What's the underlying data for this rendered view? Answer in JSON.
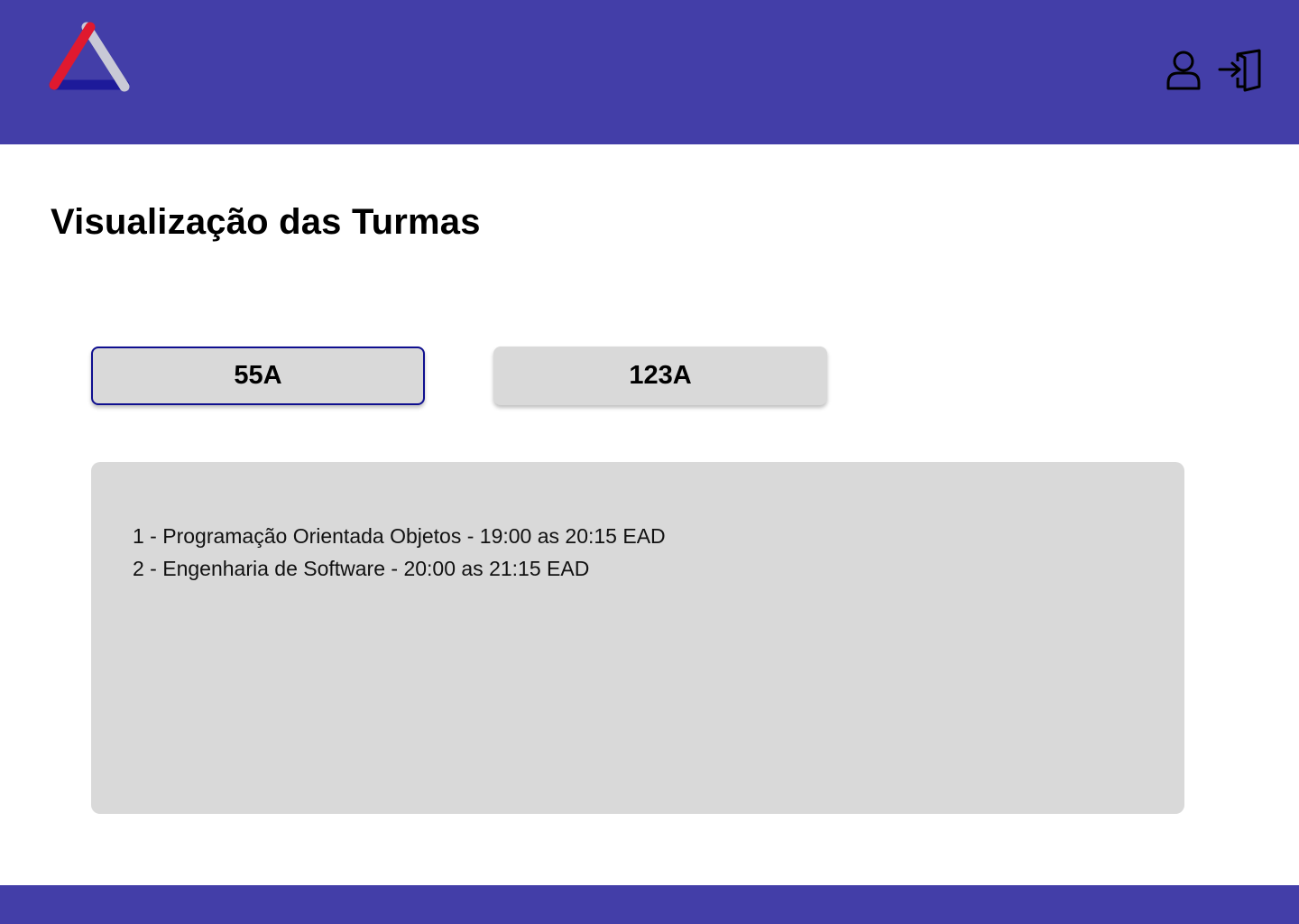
{
  "header": {
    "logo_icon": "triangle-logo-icon",
    "user_icon": "user-icon",
    "logout_icon": "logout-door-icon"
  },
  "page": {
    "title": "Visualização das Turmas"
  },
  "tabs": [
    {
      "label": "55A",
      "active": true
    },
    {
      "label": "123A",
      "active": false
    }
  ],
  "classes": [
    {
      "text": "1 - Programação Orientada Objetos - 19:00 as 20:15 EAD"
    },
    {
      "text": "2 - Engenharia de Software - 20:00 as 21:15 EAD"
    }
  ],
  "colors": {
    "brand": "#433ea8",
    "panel": "#d9d9d9",
    "active_border": "#0f0f8f",
    "logo_red": "#e0192f",
    "logo_navy": "#1d1a9a",
    "logo_gray": "#c9c9d6"
  }
}
